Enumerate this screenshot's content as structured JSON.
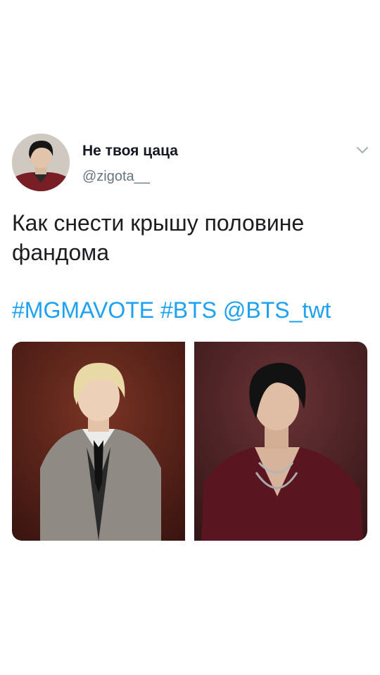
{
  "tweet": {
    "display_name": "Не твоя цаца",
    "handle": "@zigota__",
    "text": "Как снести крышу половине фандома",
    "links": [
      "#MGMAVOTE",
      "#BTS",
      "@BTS_twt"
    ],
    "menu_icon": "chevron-down-icon"
  },
  "colors": {
    "link": "#1da1f2",
    "name": "#141823",
    "handle": "#66757f",
    "text": "#1b1d21"
  }
}
